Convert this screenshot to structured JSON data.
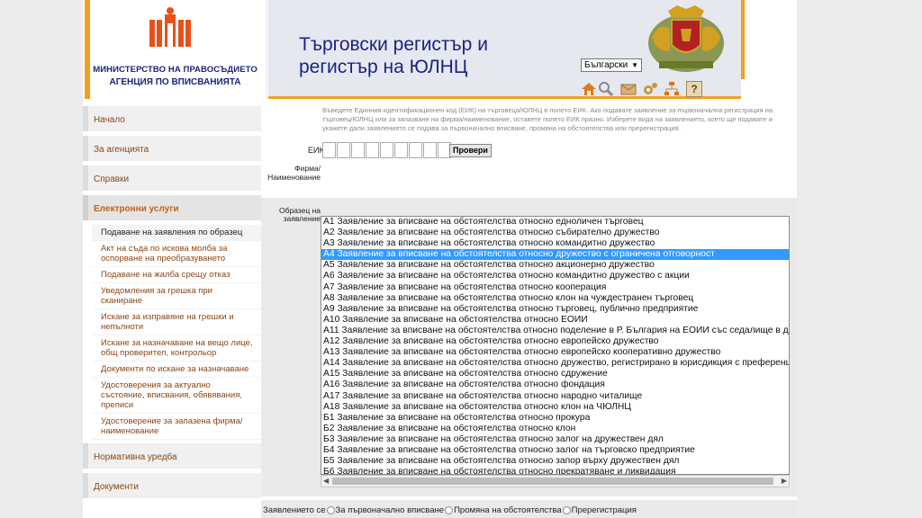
{
  "header": {
    "ministry_line1": "МИНИСТЕРСТВО НА ПРАВОСЪДИЕТО",
    "ministry_line2": "АГЕНЦИЯ ПО ВПИСВАНИЯТА",
    "title_line1": "Търговски регистър и",
    "title_line2": "регистър на ЮЛНЦ",
    "language": "Български",
    "toolbar_icons": [
      "home-icon",
      "search-icon",
      "mail-icon",
      "settings-icon",
      "sitemap-icon",
      "help-icon"
    ],
    "help_glyph": "?",
    "accent_color": "#f0a020",
    "title_color": "#1a237e"
  },
  "sidebar": {
    "items": [
      {
        "label": "Начало"
      },
      {
        "label": "За агенцията"
      },
      {
        "label": "Справки"
      },
      {
        "label": "Електронни услуги"
      }
    ],
    "subitems": [
      {
        "label": "Подаване на заявления по образец"
      },
      {
        "label": "Акт на съда по искова молба за оспорване на преобразуването"
      },
      {
        "label": "Подаване на жалба срещу отказ"
      },
      {
        "label": "Уведомления за грешка при сканиране"
      },
      {
        "label": "Искане за изправяне на грешки и непълноти"
      },
      {
        "label": "Искане за назначаване на вещо лице, общ проверител, контрольор"
      },
      {
        "label": "Документи по искане за назначаване"
      },
      {
        "label": "Удостоверения за актуално състояние, вписвания, обявявания, преписи"
      },
      {
        "label": "Удостоверение за запазена фирма/ наименование"
      }
    ],
    "bottom_items": [
      {
        "label": "Нормативна уредба"
      },
      {
        "label": "Документи"
      }
    ]
  },
  "main": {
    "info": "Въведете Единния идентификационен код (ЕИК) на търговеца/ЮЛНЦ в полето ЕИК. Ако подавате заявление за първоначална регистрация на търговец/ЮЛНЦ или за запазване на фирма/наименование, оставете полето ЕИК празно. Изберете вида на заявлението, което ще подавате и укажете дали заявлението се подава за първоначално вписване, промяна на обстоятелства или пререгистрация.",
    "eik_label": "ЕИК",
    "eik_value": "",
    "check_button": "Провери",
    "firm_label": "Фирма/ Наименование",
    "sample_label": "Образец на заявление",
    "selected_index": 3,
    "application_types": [
      "А1 Заявление за вписване на обстоятелства относно едноличен търговец",
      "А2 Заявление за вписване на обстоятелства относно събирателно дружество",
      "А3 Заявление за вписване на обстоятелства относно командитно дружество",
      "А4 Заявление за вписване на обстоятелства относно дружество с ограничена отговорност",
      "А5 Заявление за вписване на обстоятелства относно акционерно дружество",
      "А6 Заявление за вписване на обстоятелства относно командитно дружество с акции",
      "А7 Заявление за вписване на обстоятелства относно кооперация",
      "А8 Заявление за вписване на обстоятелства относно клон на чуждестранен търговец",
      "А9 Заявление за вписване на обстоятелства относно търговец, публично предприятие",
      "А10 Заявление за вписване на обстоятелства относно ЕОИИ",
      "А11 Заявление за вписване на обстоятелства относно поделение в Р. България на ЕОИИ със седалище в др. д",
      "А12 Заявление за вписване на обстоятелства относно европейско дружество",
      "А13 Заявление за вписване на обстоятелства относно европейско кооперативно дружество",
      "А14 Заявление за вписване на обстоятелства относно дружество, регистрирано в юрисдикция с преференциа",
      "А15 Заявление за вписване на обстоятелства относно сдружение",
      "А16 Заявление за вписване на обстоятелства относно фондация",
      "А17 Заявление за вписване на обстоятелства относно народно читалище",
      "А18 Заявление за вписване на обстоятелства относно клон на ЧЮЛНЦ",
      "Б1 Заявление за вписване на обстоятелства относно прокура",
      "Б2 Заявление за вписване на обстоятелства относно клон",
      "Б3 Заявление за вписване на обстоятелства относно залог на дружествен дял",
      "Б4 Заявление за вписване на обстоятелства относно залог на търговско предприятие",
      "Б5 Заявление за вписване на обстоятелства относно запор върху дружествен дял",
      "Б6 Заявление за вписване на обстоятелства относно прекратяване и ликвидация"
    ],
    "radio_label": "Заявлението се",
    "radio_options": [
      "За първоначално вписване",
      "Промяна на обстоятелства",
      "Пререгистрация"
    ]
  }
}
